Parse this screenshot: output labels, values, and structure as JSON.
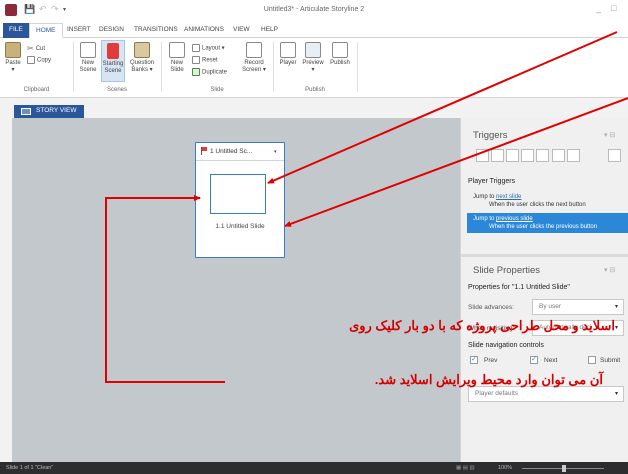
{
  "window": {
    "title": "Untitled3* - Articulate Storyline 2",
    "controls": [
      "_",
      "□"
    ]
  },
  "quick_access": [
    "💾",
    "↶",
    "↷",
    "▾"
  ],
  "ribbon_tabs": [
    {
      "label": "FILE",
      "state": "file"
    },
    {
      "label": "HOME",
      "state": "active"
    },
    {
      "label": "INSERT",
      "state": ""
    },
    {
      "label": "DESIGN",
      "state": ""
    },
    {
      "label": "TRANSITIONS",
      "state": ""
    },
    {
      "label": "ANIMATIONS",
      "state": ""
    },
    {
      "label": "VIEW",
      "state": ""
    },
    {
      "label": "HELP",
      "state": ""
    }
  ],
  "ribbon": {
    "paste": "Paste",
    "paste_caret": "▾",
    "cut": "Cut",
    "copy": "Copy",
    "new_scene_1": "New",
    "new_scene_2": "Scene",
    "starting_scene_1": "Starting",
    "starting_scene_2": "Scene",
    "question_banks_1": "Question",
    "question_banks_2": "Banks ▾",
    "new_slide_1": "New",
    "new_slide_2": "Slide",
    "layout": "Layout ▾",
    "reset": "Reset",
    "duplicate": "Duplicate",
    "record_screen_1": "Record",
    "record_screen_2": "Screen ▾",
    "player": "Player",
    "preview": "Preview",
    "preview_caret": "▾",
    "publish": "Publish",
    "groups": {
      "clipboard": "Clipboard",
      "scenes": "Scenes",
      "slide": "Slide",
      "publish": "Publish"
    }
  },
  "story_view_tab": "STORY VIEW",
  "scene": {
    "title": "1 Untitled Sc...",
    "caret": "▾",
    "slide_label": "1.1 Untitled Slide"
  },
  "triggers": {
    "title": "Triggers",
    "title_controls": "▾ ⊟",
    "player_triggers": "Player Triggers",
    "items": [
      {
        "prefix": "Jump to ",
        "link": "next slide",
        "detail": "When the user clicks the next button",
        "selected": false
      },
      {
        "prefix": "Jump to ",
        "link": "previous slide",
        "detail": "When the user clicks the previous button",
        "selected": true
      }
    ]
  },
  "slide_properties": {
    "title": "Slide Properties",
    "title_controls": "▾ ⊟",
    "properties_for": "Properties for \"1.1 Untitled Slide\"",
    "slide_advances_label": "Slide advances:",
    "slide_advances_value": "By user",
    "when_revisiting_label": "When revisiting:",
    "when_revisiting_value": "Automatically deci",
    "nav_controls_label": "Slide navigation controls",
    "checkboxes": [
      "Prev",
      "Next",
      "Submit"
    ],
    "player_features_value": "Player defaults",
    "caret": "▾"
  },
  "statusbar": {
    "text": "Slide 1 of 1    \"Clean\"",
    "zoom": "100%"
  },
  "annotation": {
    "line1": "اسلاید و محل طراحی پروژه که با  دو بار کلیک روی",
    "line2": "آن می توان وارد محیط ویرایش اسلاید شد."
  },
  "colors": {
    "accent": "#2b579a",
    "selection": "#2b88d8",
    "annotation": "#d40000",
    "canvas": "#c3c8cd"
  }
}
